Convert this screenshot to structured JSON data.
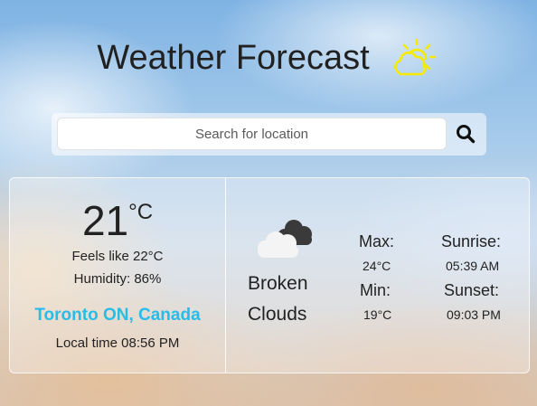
{
  "header": {
    "title": "Weather Forecast",
    "icon": "partly-sunny-icon",
    "icon_color": "#f5ea00"
  },
  "search": {
    "placeholder": "Search for location",
    "value": "",
    "button_icon": "search-icon"
  },
  "current": {
    "temperature": "21",
    "unit": "°C",
    "feels_like": "Feels like 22°C",
    "humidity": "Humidity: 86%",
    "location": "Toronto ON, Canada",
    "location_color": "#27bde8",
    "local_time": "Local time 08:56 PM"
  },
  "conditions": {
    "icon": "broken-clouds-icon",
    "description_line1": "Broken",
    "description_line2": "Clouds"
  },
  "stats": {
    "max_label": "Max:",
    "max_value": "24°C",
    "min_label": "Min:",
    "min_value": "19°C",
    "sunrise_label": "Sunrise:",
    "sunrise_value": "05:39 AM",
    "sunset_label": "Sunset:",
    "sunset_value": "09:03 PM"
  }
}
